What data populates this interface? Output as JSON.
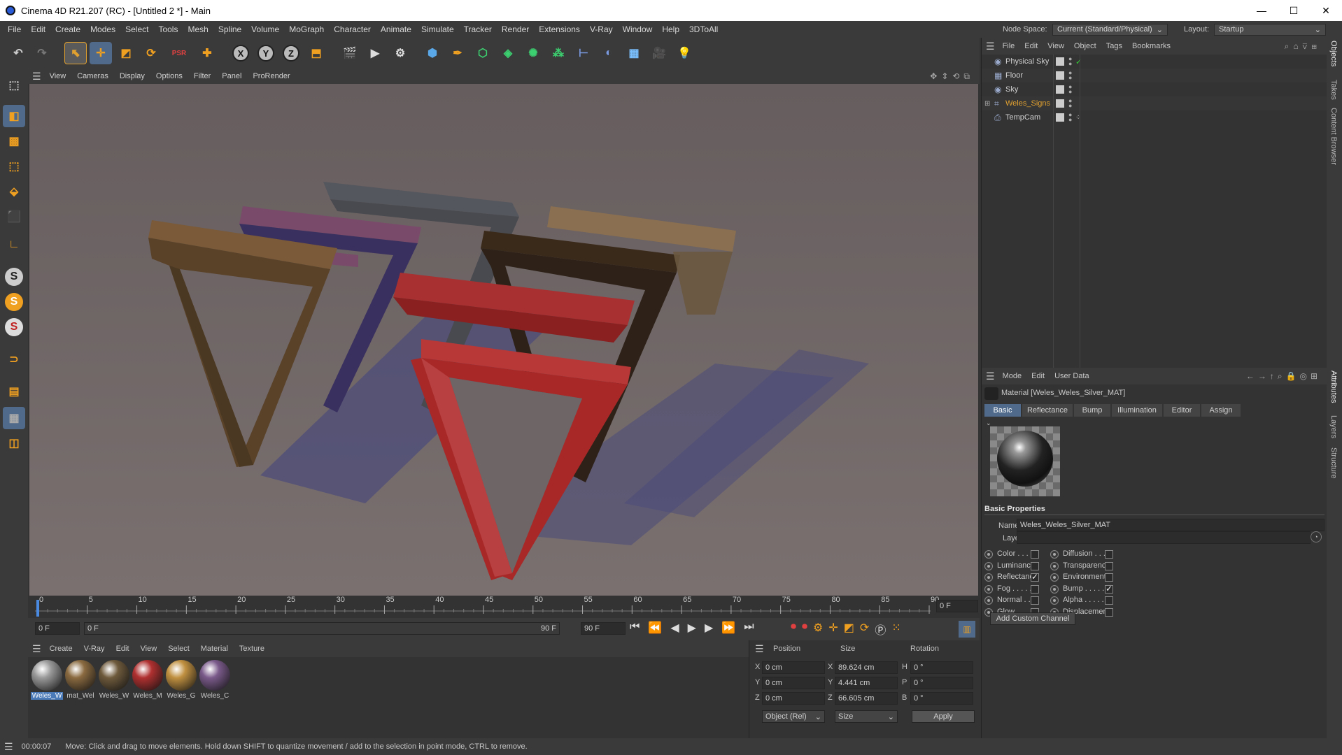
{
  "window": {
    "title": "Cinema 4D R21.207 (RC) - [Untitled 2 *] - Main",
    "minimize": "—",
    "maximize": "☐",
    "close": "✕"
  },
  "menu": [
    "File",
    "Edit",
    "Create",
    "Modes",
    "Select",
    "Tools",
    "Mesh",
    "Spline",
    "Volume",
    "MoGraph",
    "Character",
    "Animate",
    "Simulate",
    "Tracker",
    "Render",
    "Extensions",
    "V-Ray",
    "Window",
    "Help",
    "3DToAll"
  ],
  "node_space": {
    "label": "Node Space:",
    "value": "Current (Standard/Physical)"
  },
  "layout": {
    "label": "Layout:",
    "value": "Startup"
  },
  "toolbar": {
    "x_label": "X",
    "y_label": "Y",
    "z_label": "Z",
    "active_tool": "move"
  },
  "viewport_menu": [
    "View",
    "Cameras",
    "Display",
    "Options",
    "Filter",
    "Panel",
    "ProRender"
  ],
  "left_tools": {
    "s1": "S",
    "s2": "S",
    "s3": "S"
  },
  "timeline": {
    "ticks": [
      "0",
      "5",
      "10",
      "15",
      "20",
      "25",
      "30",
      "35",
      "40",
      "45",
      "50",
      "55",
      "60",
      "65",
      "70",
      "75",
      "80",
      "85",
      "90"
    ],
    "current_frame": "0 F",
    "start": "0 F",
    "range_start": "0 F",
    "range_end": "90 F",
    "end": "90 F"
  },
  "material_menu": [
    "Create",
    "V-Ray",
    "Edit",
    "View",
    "Select",
    "Material",
    "Texture"
  ],
  "materials": [
    {
      "label": "Weles_W",
      "color": "#9a9a9a",
      "selected": true
    },
    {
      "label": "mat_Wel",
      "color": "#8a6a40"
    },
    {
      "label": "Weles_W",
      "color": "#6e5a3c"
    },
    {
      "label": "Weles_M",
      "color": "#b03030"
    },
    {
      "label": "Weles_G",
      "color": "#c09040"
    },
    {
      "label": "Weles_C",
      "color": "#7a5a8a"
    }
  ],
  "coords": {
    "headers": {
      "position": "Position",
      "size": "Size",
      "rotation": "Rotation"
    },
    "rows": [
      {
        "axis": "X",
        "pos": "0 cm",
        "size_axis": "X",
        "size": "89.624 cm",
        "rot_axis": "H",
        "rot": "0 °"
      },
      {
        "axis": "Y",
        "pos": "0 cm",
        "size_axis": "Y",
        "size": "4.441 cm",
        "rot_axis": "P",
        "rot": "0 °"
      },
      {
        "axis": "Z",
        "pos": "0 cm",
        "size_axis": "Z",
        "size": "66.605 cm",
        "rot_axis": "B",
        "rot": "0 °"
      }
    ],
    "mode": "Object (Rel)",
    "size_mode": "Size",
    "apply": "Apply"
  },
  "object_menu": [
    "File",
    "Edit",
    "View",
    "Object",
    "Tags",
    "Bookmarks"
  ],
  "objects": [
    {
      "name": "Physical Sky",
      "icon": "sky-icon",
      "color": "#d0d0d0",
      "highlight": false
    },
    {
      "name": "Floor",
      "icon": "floor-icon",
      "color": "#d0d0d0",
      "highlight": false
    },
    {
      "name": "Sky",
      "icon": "sky-icon",
      "color": "#d0d0d0",
      "highlight": false
    },
    {
      "name": "Weles_Signs",
      "icon": "null-icon",
      "color": "#e0a030",
      "highlight": true
    },
    {
      "name": "TempCam",
      "icon": "camera-icon",
      "color": "#d0d0d0",
      "highlight": false
    }
  ],
  "attr_menu": [
    "Mode",
    "Edit",
    "User Data"
  ],
  "attr": {
    "title": "Material [Weles_Weles_Silver_MAT]",
    "tabs": [
      "Basic",
      "Reflectance",
      "Bump",
      "Illumination",
      "Editor",
      "Assign"
    ],
    "active_tab": "Basic",
    "section": "Basic Properties",
    "name_label": "Name",
    "name_value": "Weles_Weles_Silver_MAT",
    "layer_label": "Layer",
    "layer_value": "",
    "channels_left": [
      {
        "label": "Color . . . .",
        "on": false
      },
      {
        "label": "Luminance",
        "on": false
      },
      {
        "label": "Reflectance",
        "on": true
      },
      {
        "label": "Fog . . . . .",
        "on": false
      },
      {
        "label": "Normal . . .",
        "on": false
      },
      {
        "label": "Glow . . . .",
        "on": false
      }
    ],
    "channels_right": [
      {
        "label": "Diffusion . . .",
        "on": false
      },
      {
        "label": "Transparency",
        "on": false
      },
      {
        "label": "Environment",
        "on": false
      },
      {
        "label": "Bump . . . . .",
        "on": true
      },
      {
        "label": "Alpha . . . . .",
        "on": false
      },
      {
        "label": "Displacement",
        "on": false
      }
    ],
    "add_channel": "Add Custom Channel"
  },
  "right_tabs": [
    "Objects",
    "Takes",
    "Content Browser",
    "Attributes",
    "Layers",
    "Structure"
  ],
  "status": {
    "time": "00:00:07",
    "message": "Move: Click and drag to move elements. Hold down SHIFT to quantize movement / add to the selection in point mode, CTRL to remove."
  }
}
